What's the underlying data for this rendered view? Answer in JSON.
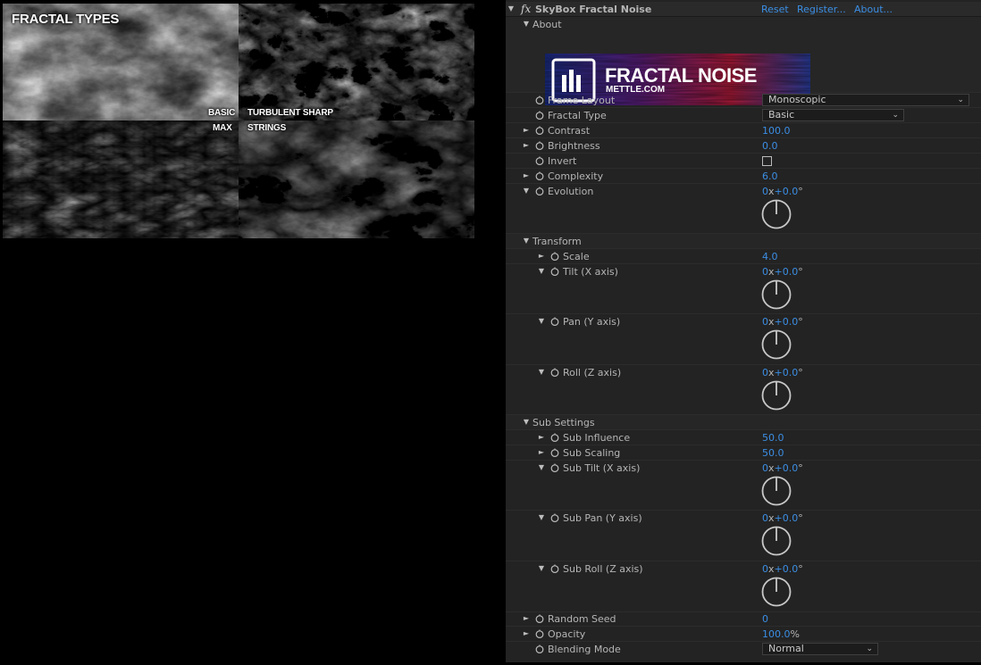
{
  "preview": {
    "title": "FRACTAL TYPES",
    "labels": {
      "basic": "BASIC",
      "turbulent": "TURBULENT SHARP",
      "max": "MAX",
      "strings": "STRINGS"
    }
  },
  "panel": {
    "effect_name": "SkyBox Fractal Noise",
    "fx_glyph": "fx",
    "links": {
      "reset": "Reset",
      "register": "Register...",
      "about": "About..."
    },
    "about": {
      "label": "About",
      "logo_text": "FRACTAL NOISE",
      "logo_sub": "METTLE.COM"
    },
    "frame_layout": {
      "label": "Frame Layout",
      "value": "Monoscopic"
    },
    "fractal_type": {
      "label": "Fractal Type",
      "value": "Basic"
    },
    "contrast": {
      "label": "Contrast",
      "value": "100.0"
    },
    "brightness": {
      "label": "Brightness",
      "value": "0.0"
    },
    "invert": {
      "label": "Invert",
      "checked": false
    },
    "complexity": {
      "label": "Complexity",
      "value": "6.0"
    },
    "evolution": {
      "label": "Evolution",
      "rev": "0",
      "x": "x",
      "deg": "+0.0",
      "sym": "°"
    },
    "transform": {
      "label": "Transform",
      "scale": {
        "label": "Scale",
        "value": "4.0"
      },
      "tilt": {
        "label": "Tilt (X axis)",
        "rev": "0",
        "x": "x",
        "deg": "+0.0",
        "sym": "°"
      },
      "pan": {
        "label": "Pan (Y axis)",
        "rev": "0",
        "x": "x",
        "deg": "+0.0",
        "sym": "°"
      },
      "roll": {
        "label": "Roll (Z axis)",
        "rev": "0",
        "x": "x",
        "deg": "+0.0",
        "sym": "°"
      }
    },
    "sub_settings": {
      "label": "Sub Settings",
      "influence": {
        "label": "Sub Influence",
        "value": "50.0"
      },
      "scaling": {
        "label": "Sub Scaling",
        "value": "50.0"
      },
      "tilt": {
        "label": "Sub Tilt (X axis)",
        "rev": "0",
        "x": "x",
        "deg": "+0.0",
        "sym": "°"
      },
      "pan": {
        "label": "Sub Pan (Y axis)",
        "rev": "0",
        "x": "x",
        "deg": "+0.0",
        "sym": "°"
      },
      "roll": {
        "label": "Sub Roll (Z axis)",
        "rev": "0",
        "x": "x",
        "deg": "+0.0",
        "sym": "°"
      }
    },
    "random_seed": {
      "label": "Random Seed",
      "value": "0"
    },
    "opacity": {
      "label": "Opacity",
      "value": "100.0",
      "unit": "%"
    },
    "blending_mode": {
      "label": "Blending Mode",
      "value": "Normal"
    },
    "glyphs": {
      "expanded": "▼",
      "collapsed": "►",
      "dropdown": "⌄"
    },
    "colors": {
      "panel_bg": "#232323",
      "value_blue": "#3b8ee4",
      "label": "#b5b5b5"
    }
  }
}
